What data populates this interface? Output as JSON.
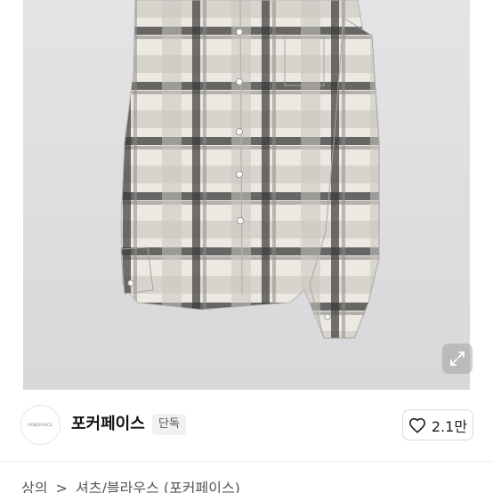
{
  "shop": {
    "name": "포커페이스",
    "logo_text": "POKERFACE",
    "badge": "단독"
  },
  "like": {
    "count": "2.1만",
    "icon": "heart-outline-icon"
  },
  "expand": {
    "icon": "expand-arrows-icon"
  },
  "breadcrumb": {
    "category": "상의",
    "separator": ">",
    "subcategory": "셔츠/블라우스 (포커페이스)"
  },
  "colors": {
    "photo_bg": "#dcdcde",
    "plaid_light": "#eeebe6",
    "plaid_dark": "#2a2a2a",
    "badge_bg": "#f1f1f3"
  }
}
